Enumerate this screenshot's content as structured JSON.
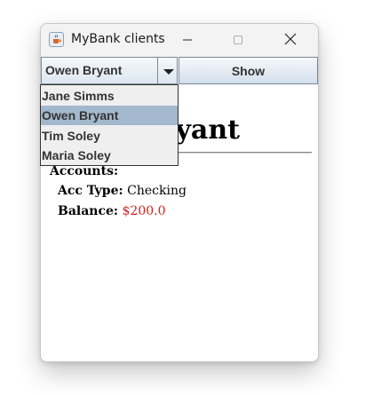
{
  "window": {
    "title": "MyBank clients",
    "icons": {
      "app": "java-cup-icon",
      "minimize": "minimize-icon",
      "maximize": "maximize-icon",
      "close": "close-icon"
    }
  },
  "toolbar": {
    "combo_selected": "Owen Bryant",
    "combo_arrow_icon": "chevron-down-icon",
    "show_label": "Show"
  },
  "dropdown": {
    "items": [
      {
        "label": "Jane Simms",
        "selected": false
      },
      {
        "label": "Owen Bryant",
        "selected": true
      },
      {
        "label": "Tim Soley",
        "selected": false
      },
      {
        "label": "Maria Soley",
        "selected": false
      }
    ]
  },
  "details": {
    "client_name": "Owen Bryant",
    "accounts_label": "Accounts:",
    "acc_type_label": "Acc Type:",
    "acc_type_value": " Checking",
    "balance_label": "Balance:",
    "balance_value": " $200.0"
  },
  "colors": {
    "selection": "#a3b8cc",
    "balance": "#dd1c1c",
    "button_gradient_top": "#f6f8fb",
    "button_gradient_bottom": "#d2dfec"
  }
}
